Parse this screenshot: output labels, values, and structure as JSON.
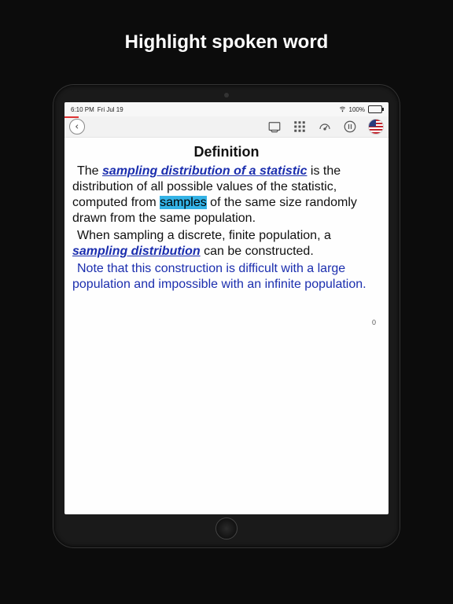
{
  "caption": "Highlight spoken word",
  "status": {
    "time": "6:10 PM",
    "date": "Fri Jul 19",
    "battery": "100%"
  },
  "toolbar": {
    "back_icon": "chevron-left",
    "icons": [
      "display-icon",
      "grid-icon",
      "speed-icon",
      "pause-icon",
      "flag-icon"
    ]
  },
  "doc": {
    "title": "Definition",
    "p1": {
      "t1": "The ",
      "term": "sampling distribution of a statistic",
      "t2": " is the distribution of all possible values of the statistic, computed from ",
      "highlight": "samples",
      "t3": " of the same size randomly drawn from the same population."
    },
    "p2": {
      "t1": "When sampling a discrete, finite population, a ",
      "term": "sampling distribution",
      "t2": " can be constructed."
    },
    "note": "Note that this construction is difficult with a large population and impossible with an infinite population.",
    "slide_index": "0"
  }
}
